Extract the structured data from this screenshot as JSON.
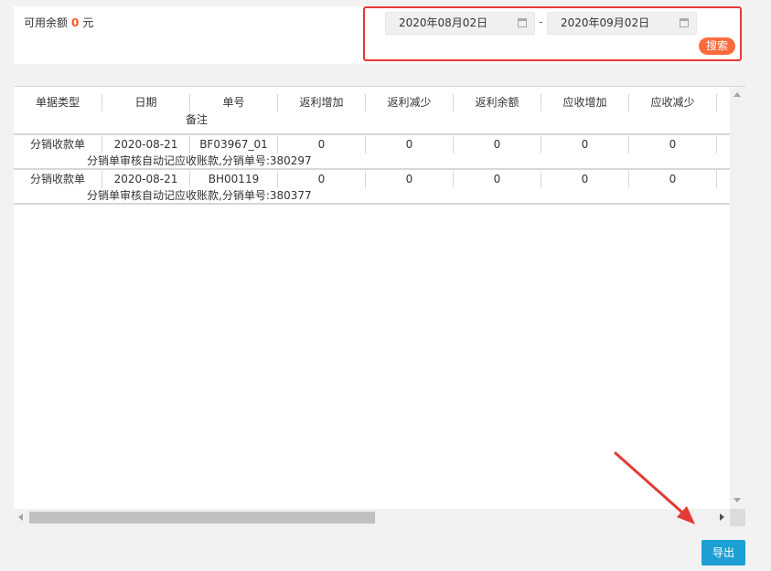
{
  "balance": {
    "label": "可用余额",
    "value": "0",
    "unit": "元"
  },
  "filter": {
    "start_date": "2020年08月02日",
    "separator": "-",
    "end_date": "2020年09月02日",
    "search_label": "搜索"
  },
  "table": {
    "headers": [
      "单据类型",
      "日期",
      "单号",
      "返利增加",
      "返利减少",
      "返利余额",
      "应收增加",
      "应收减少"
    ],
    "header_sub": "备注",
    "rows": [
      {
        "cells": [
          "分销收款单",
          "2020-08-21",
          "BF03967_01",
          "0",
          "0",
          "0",
          "0",
          "0"
        ],
        "note": "分销单审核自动记应收账款,分销单号:380297"
      },
      {
        "cells": [
          "分销收款单",
          "2020-08-21",
          "BH00119",
          "0",
          "0",
          "0",
          "0",
          "0"
        ],
        "note": "分销单审核自动记应收账款,分销单号:380377"
      }
    ]
  },
  "export_label": "导出",
  "colors": {
    "accent_orange": "#ff5722",
    "highlight_red": "#e53935",
    "export_blue": "#1e9fd4"
  }
}
